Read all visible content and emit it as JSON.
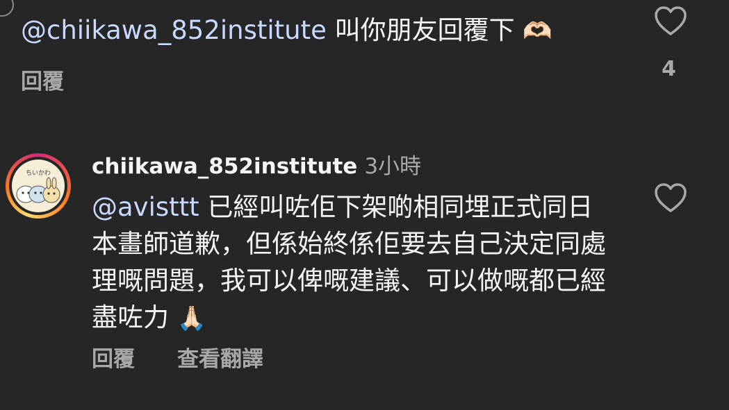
{
  "comment1": {
    "mention": "@chiikawa_852institute",
    "text": " 叫你朋友回覆下",
    "emoji": "🫶🏻",
    "reply_label": "回覆",
    "like_count": "4"
  },
  "comment2": {
    "username": "chiikawa_852institute",
    "time": "3小時",
    "mention": "@avisttt",
    "text": " 已經叫咗佢下架啲相同埋正式同日本畫師道歉，但係始終係佢要去自己決定同處理嘅問題，我可以俾嘅建議、可以做嘅都已經盡咗力",
    "emoji": "🙏🏻",
    "reply_label": "回覆",
    "translate_label": "查看翻譯",
    "avatar_text": "ちいかわ"
  },
  "colors": {
    "background": "#262626",
    "mention": "#c7d9ff",
    "secondary_text": "#a8a8a8",
    "story_ring": [
      "#d62976",
      "#fa7e1e",
      "#feda75"
    ]
  },
  "icons": [
    "heart-icon",
    "avatar"
  ]
}
